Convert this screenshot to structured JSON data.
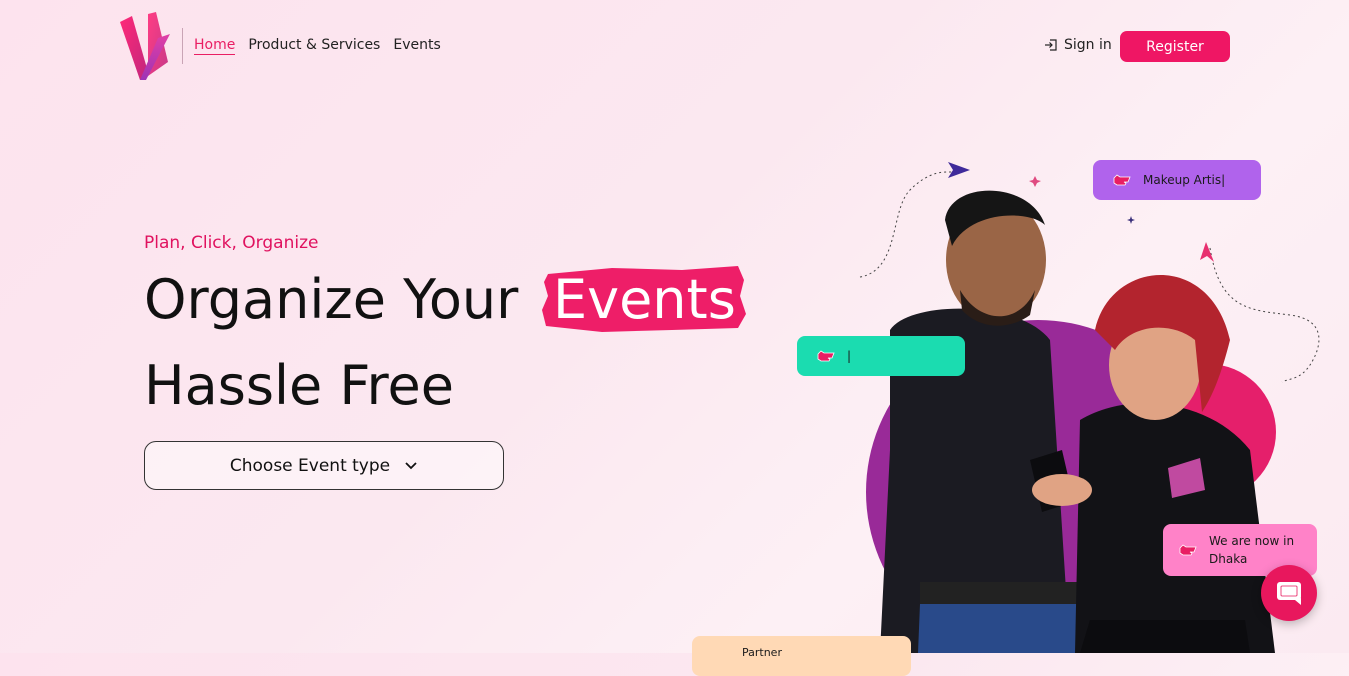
{
  "colors": {
    "accent": "#ef1664",
    "purple_pill": "#b063ec",
    "teal_pill": "#1bdcb0",
    "pink_pill": "#ff82c8",
    "peach_pill": "#ffd9b5",
    "blob_purple": "#9b2b9a",
    "blob_pink": "#e51f6b"
  },
  "nav": {
    "items": [
      {
        "label": "Home"
      },
      {
        "label": "Product & Services"
      },
      {
        "label": "Events"
      }
    ],
    "signin_label": "Sign in",
    "register_label": "Register"
  },
  "hero": {
    "tagline": "Plan, Click, Organize",
    "heading_part1": "Organize Your",
    "heading_highlight": "Events",
    "heading_line2": "Hassle Free",
    "dropdown_label": "Choose Event type"
  },
  "floating": {
    "makeup": "Makeup Artis|",
    "teal_cursor": "|",
    "dhaka_line1": "We are now in",
    "dhaka_line2": "Dhaka",
    "partner": "Partner"
  },
  "icons": {
    "signin": "sign-in-icon",
    "dropdown": "chevron-down-icon",
    "chat": "chat-icon",
    "pointer": "pointing-hand-icon"
  }
}
